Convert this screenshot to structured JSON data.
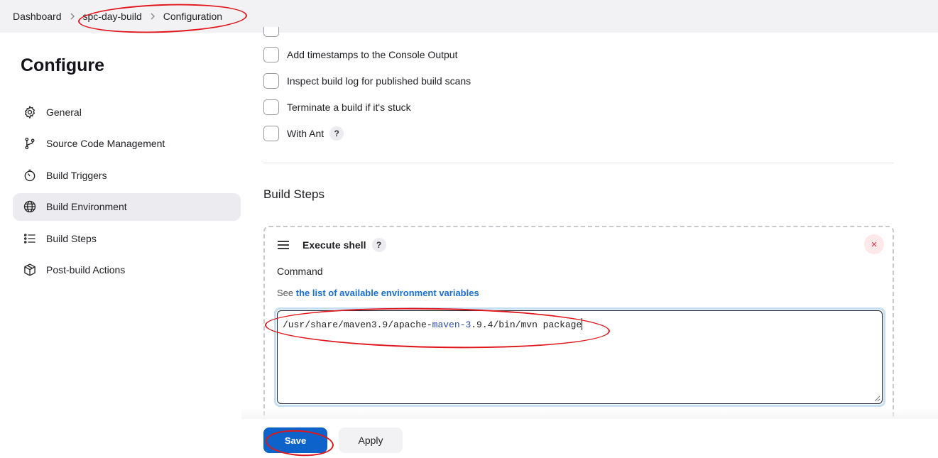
{
  "breadcrumb": {
    "items": [
      {
        "label": "Dashboard"
      },
      {
        "label": "spc-day-build"
      },
      {
        "label": "Configuration"
      }
    ]
  },
  "sidebar": {
    "title": "Configure",
    "items": [
      {
        "label": "General",
        "icon": "gear-icon"
      },
      {
        "label": "Source Code Management",
        "icon": "git-branch-icon"
      },
      {
        "label": "Build Triggers",
        "icon": "timer-icon"
      },
      {
        "label": "Build Environment",
        "icon": "globe-icon",
        "active": true
      },
      {
        "label": "Build Steps",
        "icon": "list-icon"
      },
      {
        "label": "Post-build Actions",
        "icon": "package-icon"
      }
    ]
  },
  "options": [
    {
      "label": "Add timestamps to the Console Output",
      "checked": false
    },
    {
      "label": "Inspect build log for published build scans",
      "checked": false
    },
    {
      "label": "Terminate a build if it's stuck",
      "checked": false
    },
    {
      "label": "With Ant",
      "checked": false,
      "help": "?"
    }
  ],
  "build_steps": {
    "title": "Build Steps",
    "step": {
      "name": "Execute shell",
      "help": "?",
      "close": "×",
      "command_label": "Command",
      "env_prefix": "See",
      "env_link": "the list of available environment variables",
      "command_part1": "/usr/share/maven3.9/apache-",
      "command_part2": "maven-3",
      "command_part3": ".9.4/bin/mvn package"
    }
  },
  "actions": {
    "save_label": "Save",
    "apply_label": "Apply"
  },
  "colors": {
    "primary": "#0d63c9",
    "link": "#1a6fd1",
    "annotation": "#e0161b",
    "active_bg": "#ececf0"
  }
}
